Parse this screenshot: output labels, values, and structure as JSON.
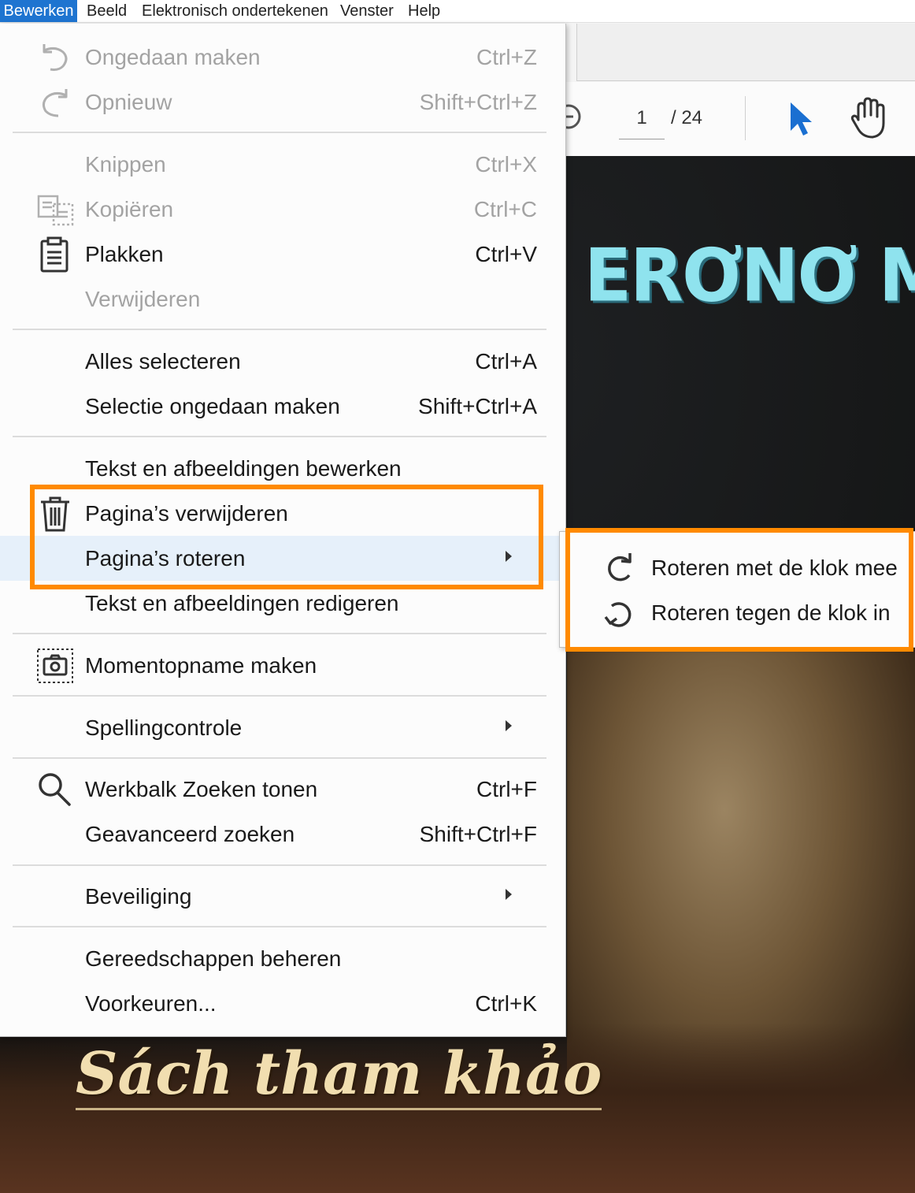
{
  "menubar": {
    "items": [
      "Bewerken",
      "Beeld",
      "Elektronisch ondertekenen",
      "Venster",
      "Help"
    ]
  },
  "toolbar": {
    "current_page": "1",
    "page_separator": "/ 24",
    "icons": [
      "zoom-out-icon",
      "select-pointer-icon",
      "hand-tool-icon"
    ]
  },
  "document": {
    "cover_title": "ERƠNƠ MU",
    "reference_text": "Sách tham khảo"
  },
  "edit_menu": {
    "undo": {
      "label": "Ongedaan maken",
      "shortcut": "Ctrl+Z",
      "icon": "undo-icon"
    },
    "redo": {
      "label": "Opnieuw",
      "shortcut": "Shift+Ctrl+Z",
      "icon": "redo-icon"
    },
    "cut": {
      "label": "Knippen",
      "shortcut": "Ctrl+X"
    },
    "copy": {
      "label": "Kopiëren",
      "shortcut": "Ctrl+C",
      "icon": "copy-icon"
    },
    "paste": {
      "label": "Plakken",
      "shortcut": "Ctrl+V",
      "icon": "clipboard-icon"
    },
    "delete": {
      "label": "Verwijderen"
    },
    "select_all": {
      "label": "Alles selecteren",
      "shortcut": "Ctrl+A"
    },
    "deselect": {
      "label": "Selectie ongedaan maken",
      "shortcut": "Shift+Ctrl+A"
    },
    "edit_text_images": {
      "label": "Tekst en afbeeldingen bewerken"
    },
    "delete_pages": {
      "label": "Pagina’s verwijderen",
      "icon": "trash-icon"
    },
    "rotate_pages": {
      "label": "Pagina’s roteren"
    },
    "redact_text_images": {
      "label": "Tekst en afbeeldingen redigeren"
    },
    "snapshot": {
      "label": "Momentopname maken",
      "icon": "camera-icon"
    },
    "spelling": {
      "label": "Spellingcontrole"
    },
    "find_toolbar": {
      "label": "Werkbalk Zoeken tonen",
      "shortcut": "Ctrl+F",
      "icon": "search-icon"
    },
    "advanced_search": {
      "label": "Geavanceerd zoeken",
      "shortcut": "Shift+Ctrl+F"
    },
    "security": {
      "label": "Beveiliging"
    },
    "manage_tools": {
      "label": "Gereedschappen beheren"
    },
    "preferences": {
      "label": "Voorkeuren...",
      "shortcut": "Ctrl+K"
    }
  },
  "rotate_submenu": {
    "clockwise": {
      "label": "Roteren met de klok mee",
      "icon": "rotate-clockwise-icon"
    },
    "counterclockwise": {
      "label": "Roteren tegen de klok in",
      "icon": "rotate-counterclockwise-icon"
    }
  },
  "colors": {
    "highlight": "#ff8a00",
    "menubar_active": "#1e74d0",
    "hover_row": "#e6f0fa",
    "disabled_text": "#a3a3a3"
  }
}
